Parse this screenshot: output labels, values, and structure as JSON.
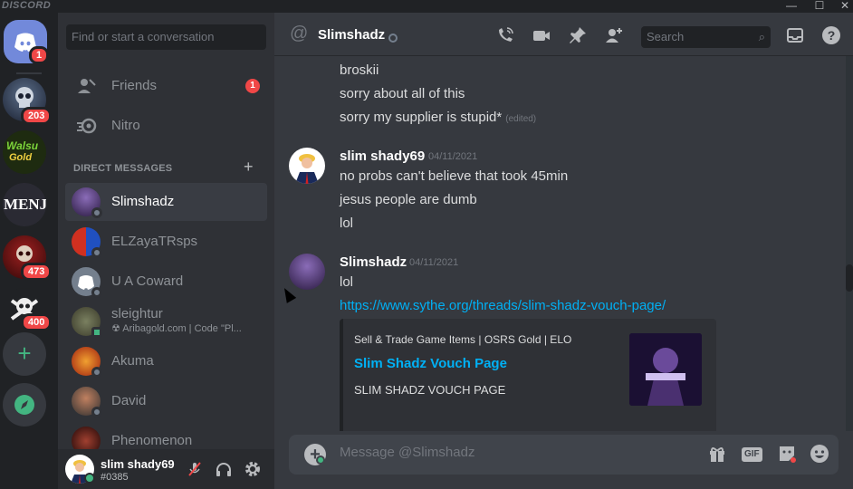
{
  "app": {
    "brand": "DISCORD"
  },
  "window_controls": {
    "minimize": "—",
    "maximize": "☐",
    "close": "✕"
  },
  "guilds": {
    "home_badge": "1",
    "servers": [
      {
        "badge": "203"
      },
      {
        "badge": ""
      },
      {
        "badge": ""
      },
      {
        "badge": "473"
      },
      {
        "badge": "400"
      }
    ],
    "add_server_glyph": "+",
    "explore_glyph": "🧭"
  },
  "sidebar": {
    "search_placeholder": "Find or start a conversation",
    "friends_label": "Friends",
    "friends_badge": "1",
    "nitro_label": "Nitro",
    "dm_header": "DIRECT MESSAGES",
    "dm_add": "+",
    "dms": [
      {
        "name": "Slimshadz",
        "sub": ""
      },
      {
        "name": "ELZayaTRsps",
        "sub": ""
      },
      {
        "name": "U A Coward",
        "sub": ""
      },
      {
        "name": "sleightur",
        "sub": "☢ Aribagold.com | Code \"Pl..."
      },
      {
        "name": "Akuma",
        "sub": ""
      },
      {
        "name": "David",
        "sub": ""
      },
      {
        "name": "Phenomenon",
        "sub": ""
      }
    ]
  },
  "user_panel": {
    "username": "slim shady69",
    "tag": "#0385"
  },
  "header": {
    "at": "@",
    "title": "Slimshadz",
    "search_placeholder": "Search"
  },
  "messages": {
    "continued": [
      "broskii",
      "sorry about all of this",
      "sorry my supplier is stupid*"
    ],
    "edited_label": "(edited)",
    "group2": {
      "author": "slim shady69",
      "timestamp": "04/11/2021",
      "lines": [
        "no probs can't believe that took 45min",
        "jesus people are dumb",
        "lol"
      ]
    },
    "group3": {
      "author": "Slimshadz",
      "timestamp": "04/11/2021",
      "lines": [
        "lol"
      ],
      "link": "https://www.sythe.org/threads/slim-shadz-vouch-page/",
      "embed": {
        "provider": "Sell & Trade Game Items | OSRS Gold | ELO",
        "title": "Slim Shadz Vouch Page",
        "description": "SLIM SHADZ VOUCH PAGE"
      }
    }
  },
  "composer": {
    "placeholder": "Message @Slimshadz",
    "gif_label": "GIF"
  },
  "colors": {
    "accent": "#7289da",
    "link": "#00b0f4",
    "badge": "#f04747",
    "online": "#43b581"
  }
}
